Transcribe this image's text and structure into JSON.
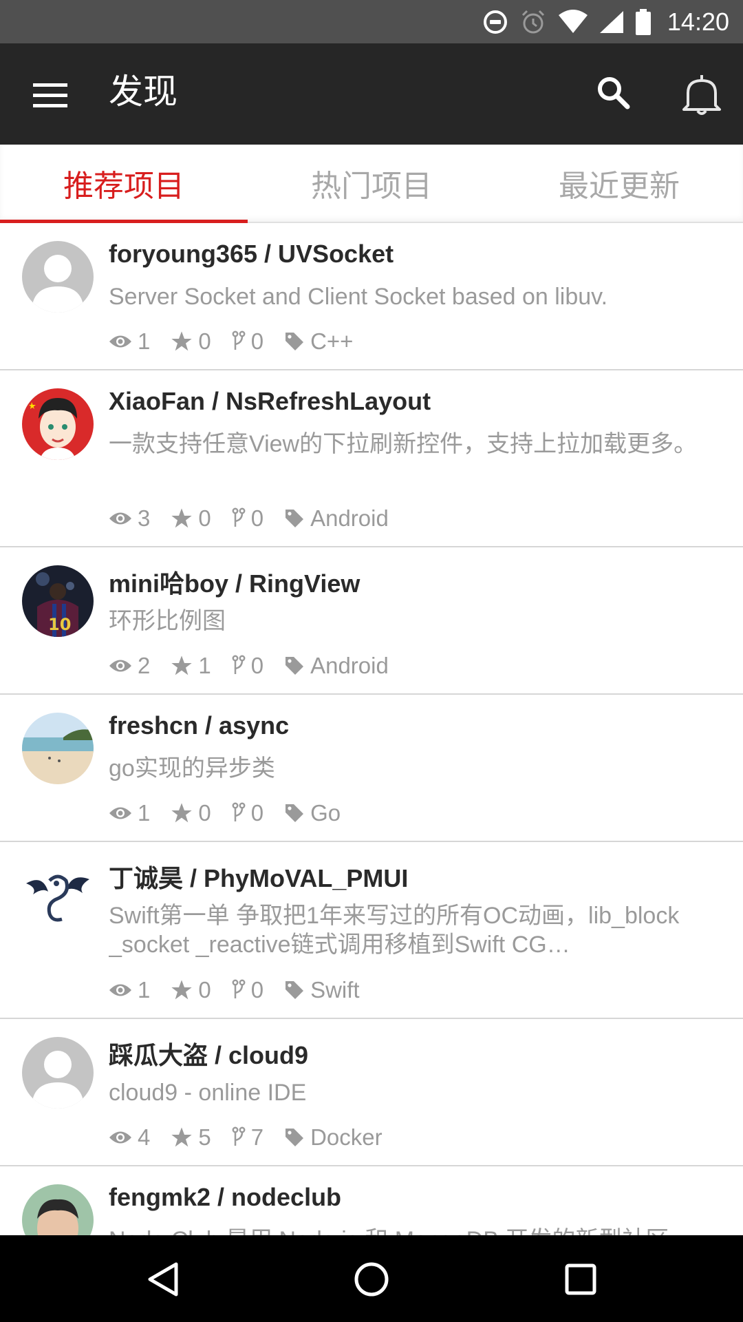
{
  "status_bar": {
    "time": "14:20",
    "icons": [
      "do-not-disturb-icon",
      "alarm-icon",
      "wifi-icon",
      "signal-icon",
      "battery-icon"
    ]
  },
  "app_bar": {
    "title": "发现",
    "icons": [
      "menu-icon",
      "search-icon",
      "bell-icon"
    ]
  },
  "tabs": [
    {
      "label": "推荐项目",
      "active": true
    },
    {
      "label": "热门项目",
      "active": false
    },
    {
      "label": "最近更新",
      "active": false
    }
  ],
  "repos": [
    {
      "name": "foryoung365 / UVSocket",
      "desc": "Server Socket and Client Socket based on libuv.",
      "watchers": "1",
      "stars": "0",
      "forks": "0",
      "language": "C++",
      "avatar": "default-avatar"
    },
    {
      "name": "XiaoFan / NsRefreshLayout",
      "desc": "一款支持任意View的下拉刷新控件，支持上拉加载更多。",
      "watchers": "3",
      "stars": "0",
      "forks": "0",
      "language": "Android",
      "avatar": "cartoon-avatar"
    },
    {
      "name": "mini哈boy / RingView",
      "desc": "环形比例图",
      "watchers": "2",
      "stars": "1",
      "forks": "0",
      "language": "Android",
      "avatar": "soccer-player-avatar"
    },
    {
      "name": "freshcn / async",
      "desc": "go实现的异步类",
      "watchers": "1",
      "stars": "0",
      "forks": "0",
      "language": "Go",
      "avatar": "beach-avatar"
    },
    {
      "name": "丁诚昊 / PhyMoVAL_PMUI",
      "desc": "Swift第一单 争取把1年来写过的所有OC动画，lib_block _socket _reactive链式调用移植到Swift CG…",
      "watchers": "1",
      "stars": "0",
      "forks": "0",
      "language": "Swift",
      "avatar": "dragon-avatar"
    },
    {
      "name": "踩瓜大盗 / cloud9",
      "desc": "cloud9 - online IDE",
      "watchers": "4",
      "stars": "5",
      "forks": "7",
      "language": "Docker",
      "avatar": "default-avatar"
    },
    {
      "name": "fengmk2 / nodeclub",
      "desc": "Node Club 是用 Node.js 和 MongoDB 开发的新型社区",
      "watchers": "",
      "stars": "",
      "forks": "",
      "language": "",
      "avatar": "person-avatar"
    }
  ],
  "nav_bar": {
    "icons": [
      "back-icon",
      "home-icon",
      "recents-icon"
    ]
  },
  "colors": {
    "accent": "#d81e1e",
    "app_bar": "#262626",
    "status_bar": "#505050",
    "secondary_text": "#9a9a9a"
  }
}
